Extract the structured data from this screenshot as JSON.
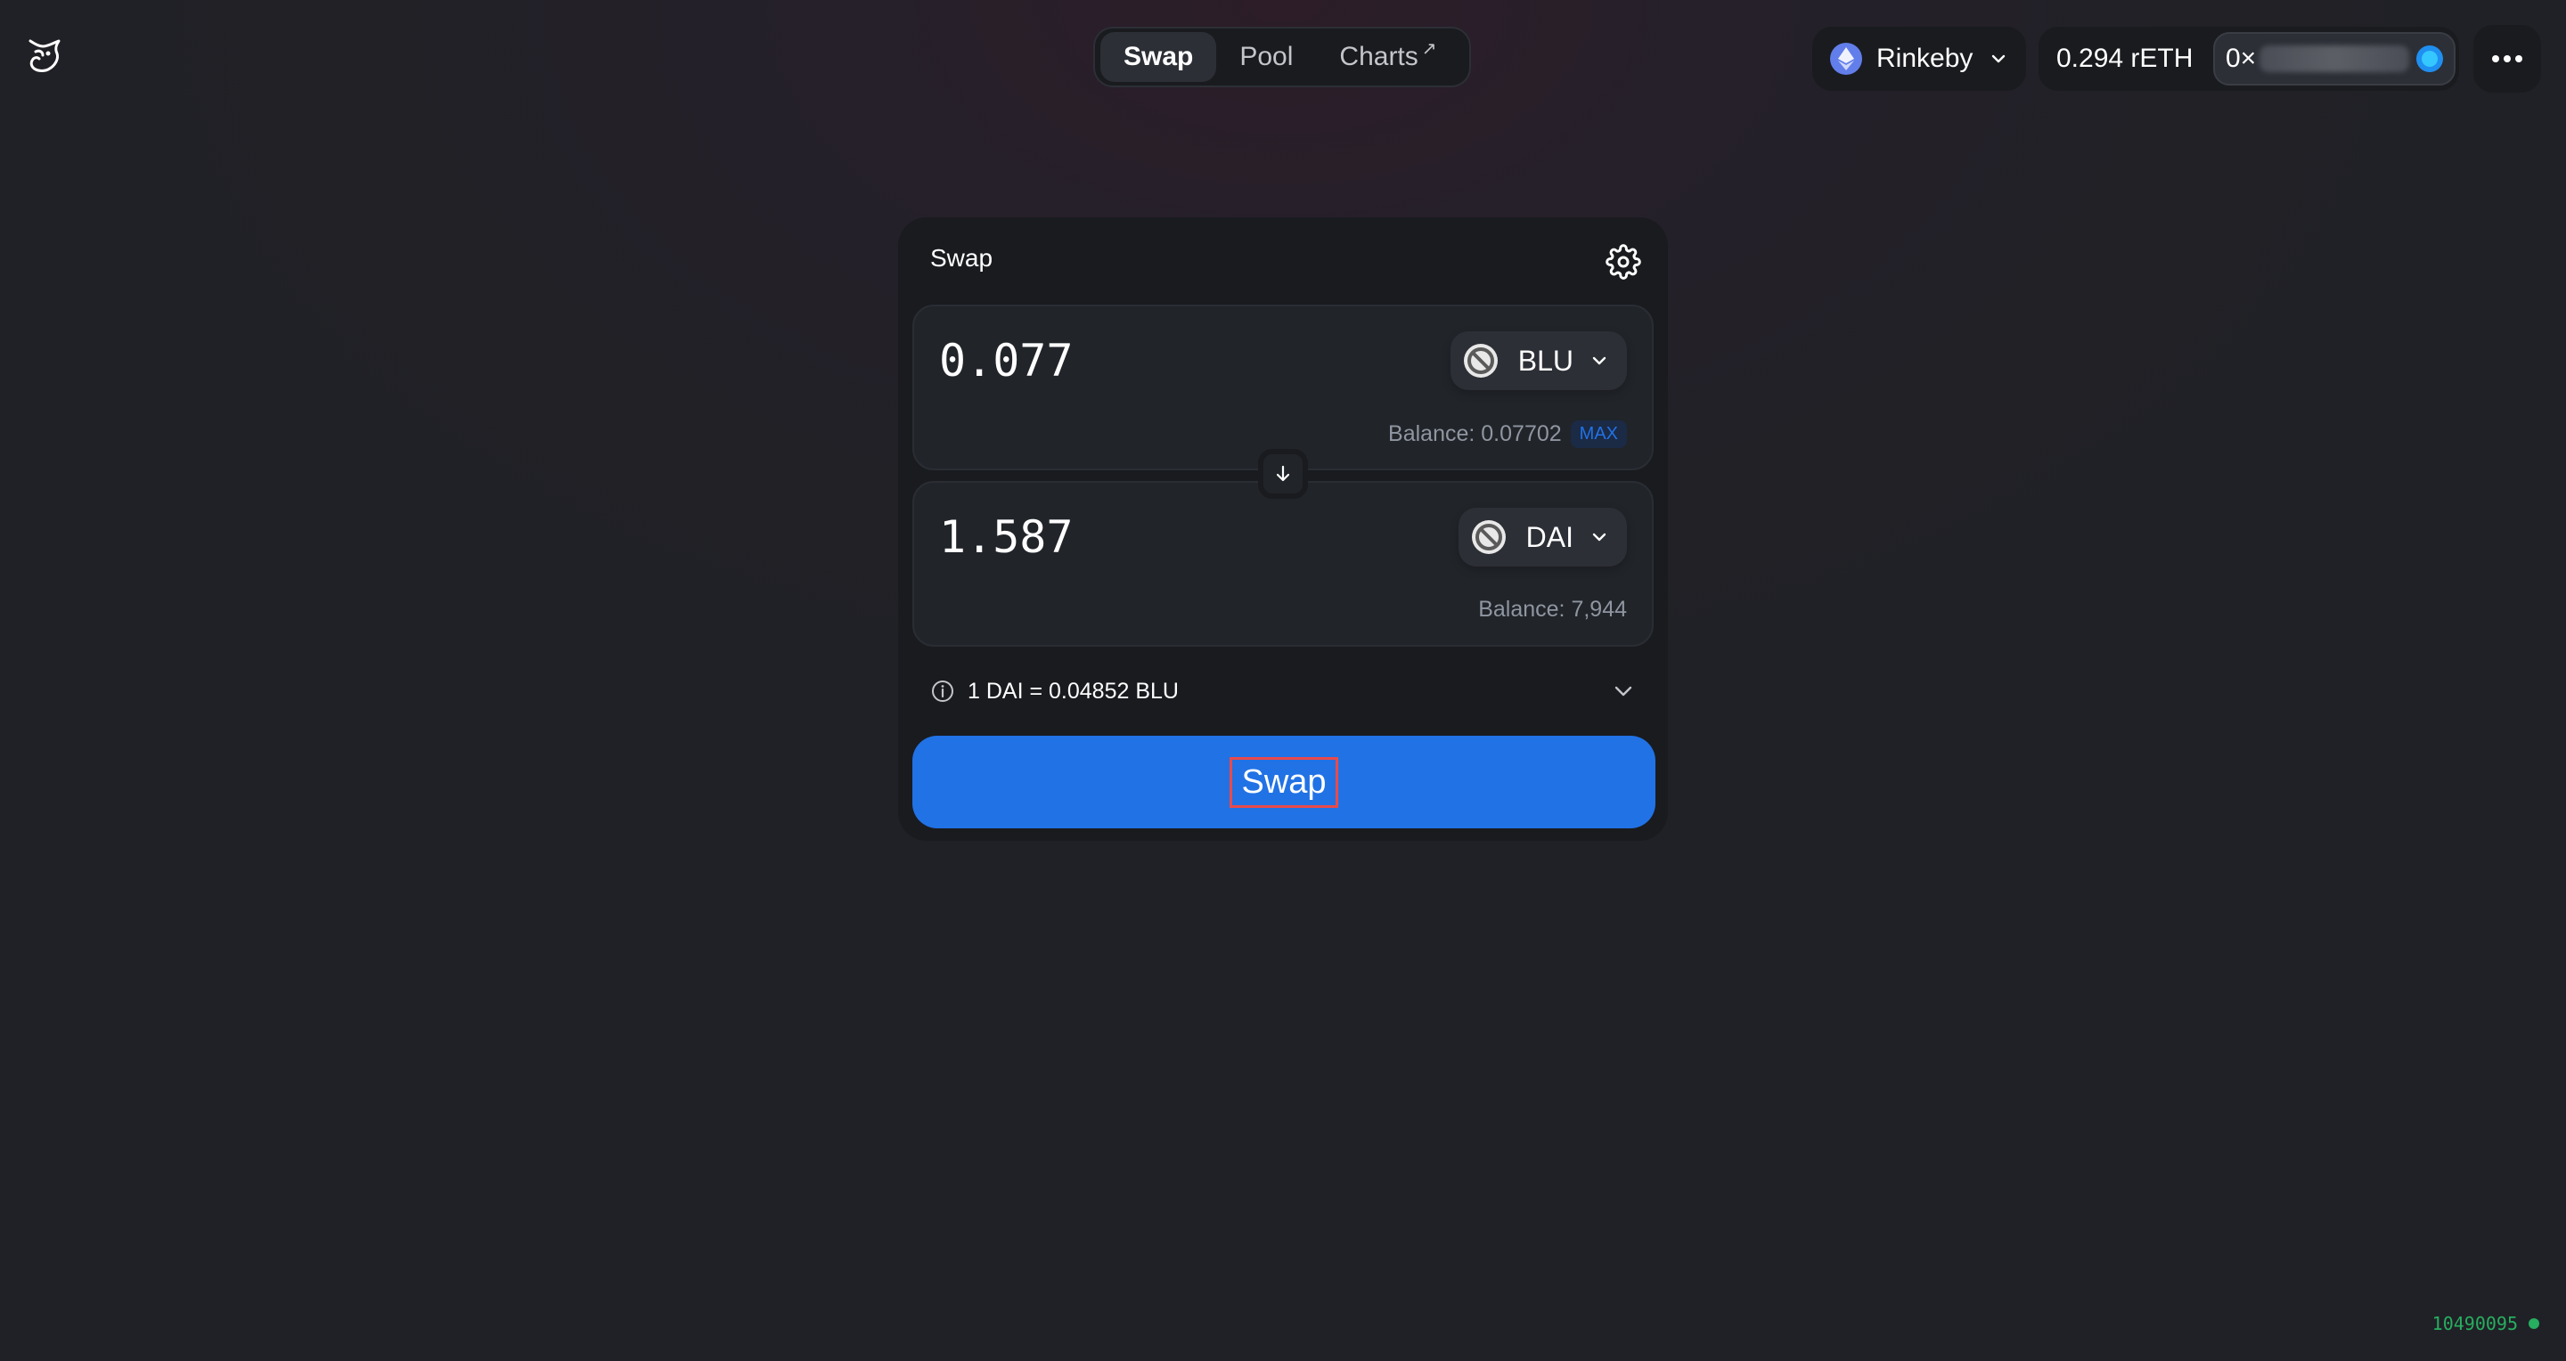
{
  "header": {
    "nav": {
      "swap": "Swap",
      "pool": "Pool",
      "charts": "Charts",
      "charts_ext": "↗"
    },
    "network": {
      "label": "Rinkeby",
      "icon": "ethereum-icon"
    },
    "account": {
      "balance": "0.294 rETH",
      "address_prefix": "0×"
    }
  },
  "swap_card": {
    "title": "Swap",
    "input": {
      "amount": "0.077",
      "token": "BLU",
      "balance": "Balance: 0.07702",
      "max_label": "MAX"
    },
    "output": {
      "amount": "1.587",
      "token": "DAI",
      "balance": "Balance: 7,944"
    },
    "rate": "1 DAI = 0.04852 BLU",
    "swap_button": "Swap"
  },
  "footer": {
    "block_number": "10490095"
  },
  "colors": {
    "accent": "#2172e5",
    "status": "#27ae60"
  }
}
